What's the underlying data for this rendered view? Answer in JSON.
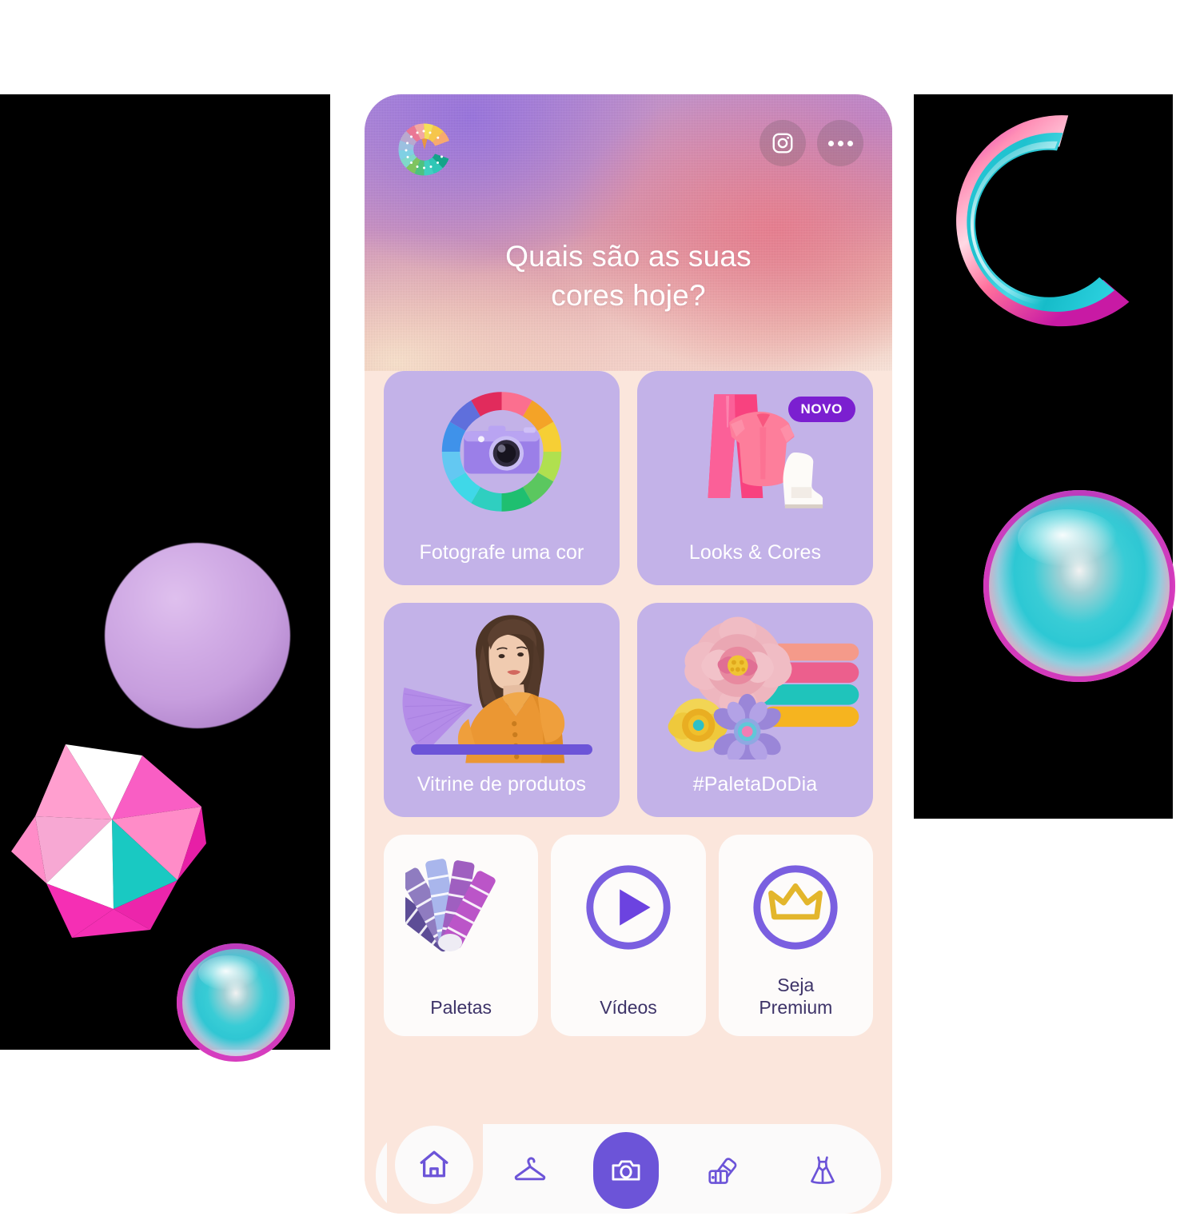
{
  "app": {
    "brand_logo_icon": "colorfy-c-wheel-logo",
    "headline_line1": "Quais são as suas",
    "headline_line2": "cores hoje?",
    "accent_purple": "#6c54d8",
    "tile_purple": "#c3b2e8",
    "body_peach": "#fbe6dc",
    "badge_purple": "#7b1fd0",
    "label_ink": "#3d3368"
  },
  "header": {
    "instagram_button": {
      "icon": "instagram-icon",
      "label": "Instagram"
    },
    "more_button": {
      "icon": "more-dots-icon",
      "label": "Mais opções"
    }
  },
  "feature_tiles": [
    {
      "id": "fotografe-uma-cor",
      "label": "Fotografe uma cor",
      "icon": "color-wheel-camera-icon",
      "badge": null,
      "wheel_colors": [
        "#f04b6e",
        "#ef3b5c",
        "#f1a12e",
        "#f4c430",
        "#b8e04a",
        "#6fd05a",
        "#2fba5a",
        "#2fc2a6",
        "#2ed0d6",
        "#4fd2ef",
        "#5ab9f2",
        "#3f8ae8",
        "#5f6fdc",
        "#7a63d8",
        "#d8406a"
      ]
    },
    {
      "id": "looks-e-cores",
      "label": "Looks & Cores",
      "icon": "pink-outfit-icon",
      "badge": "NOVO",
      "garment_colors": [
        "#f24a86",
        "#fb7b95",
        "#ffffff"
      ]
    },
    {
      "id": "vitrine-de-produtos",
      "label": "Vitrine de produtos",
      "icon": "model-orange-dress-icon",
      "badge": null,
      "dress_color": "#eb9733"
    },
    {
      "id": "paleta-do-dia",
      "label": "#PaletaDoDia",
      "icon": "paper-flowers-swatches-icon",
      "badge": null,
      "swatch_colors": [
        "#f59a8a",
        "#ec5f8d",
        "#1fc4bb",
        "#f6b41f"
      ]
    }
  ],
  "mini_tiles": [
    {
      "id": "paletas",
      "label": "Paletas",
      "icon": "palette-fan-icon",
      "fan_colors": [
        "#5d4d96",
        "#8f7cc0",
        "#a9b6ec",
        "#9f5fc0",
        "#bb55c8"
      ]
    },
    {
      "id": "videos",
      "label": "Vídeos",
      "icon": "play-circle-icon"
    },
    {
      "id": "seja-premium",
      "label_line1": "Seja",
      "label_line2": "Premium",
      "icon": "crown-circle-icon",
      "crown_color": "#e3b62c"
    }
  ],
  "bottom_nav": [
    {
      "id": "home",
      "icon": "home-icon",
      "active": false,
      "highlighted": true
    },
    {
      "id": "closet",
      "icon": "hanger-icon",
      "active": false,
      "highlighted": false
    },
    {
      "id": "camera",
      "icon": "camera-icon",
      "active": true,
      "highlighted": false
    },
    {
      "id": "palette",
      "icon": "palette-fan-icon",
      "active": false,
      "highlighted": false
    },
    {
      "id": "dress",
      "icon": "dress-icon",
      "active": false,
      "highlighted": false
    }
  ],
  "decorations": [
    {
      "id": "arc",
      "icon": "glossy-c-arc-3d",
      "colors": [
        "#2fc8d4",
        "#ff87b0",
        "#c01ba8"
      ]
    },
    {
      "id": "orb-big",
      "icon": "iridescent-orb-3d",
      "colors": [
        "#2dc8d4",
        "#cd1eaf"
      ]
    },
    {
      "id": "orb-small",
      "icon": "iridescent-orb-3d",
      "colors": [
        "#2dc8d4",
        "#cd1eaf"
      ]
    },
    {
      "id": "sphere",
      "icon": "matte-lilac-sphere-3d",
      "colors": [
        "#c79ede"
      ]
    },
    {
      "id": "icosahedron",
      "icon": "icosahedron-3d",
      "colors": [
        "#f85fc0",
        "#ff9ecb",
        "#19c9c2",
        "#ffffff"
      ]
    }
  ]
}
